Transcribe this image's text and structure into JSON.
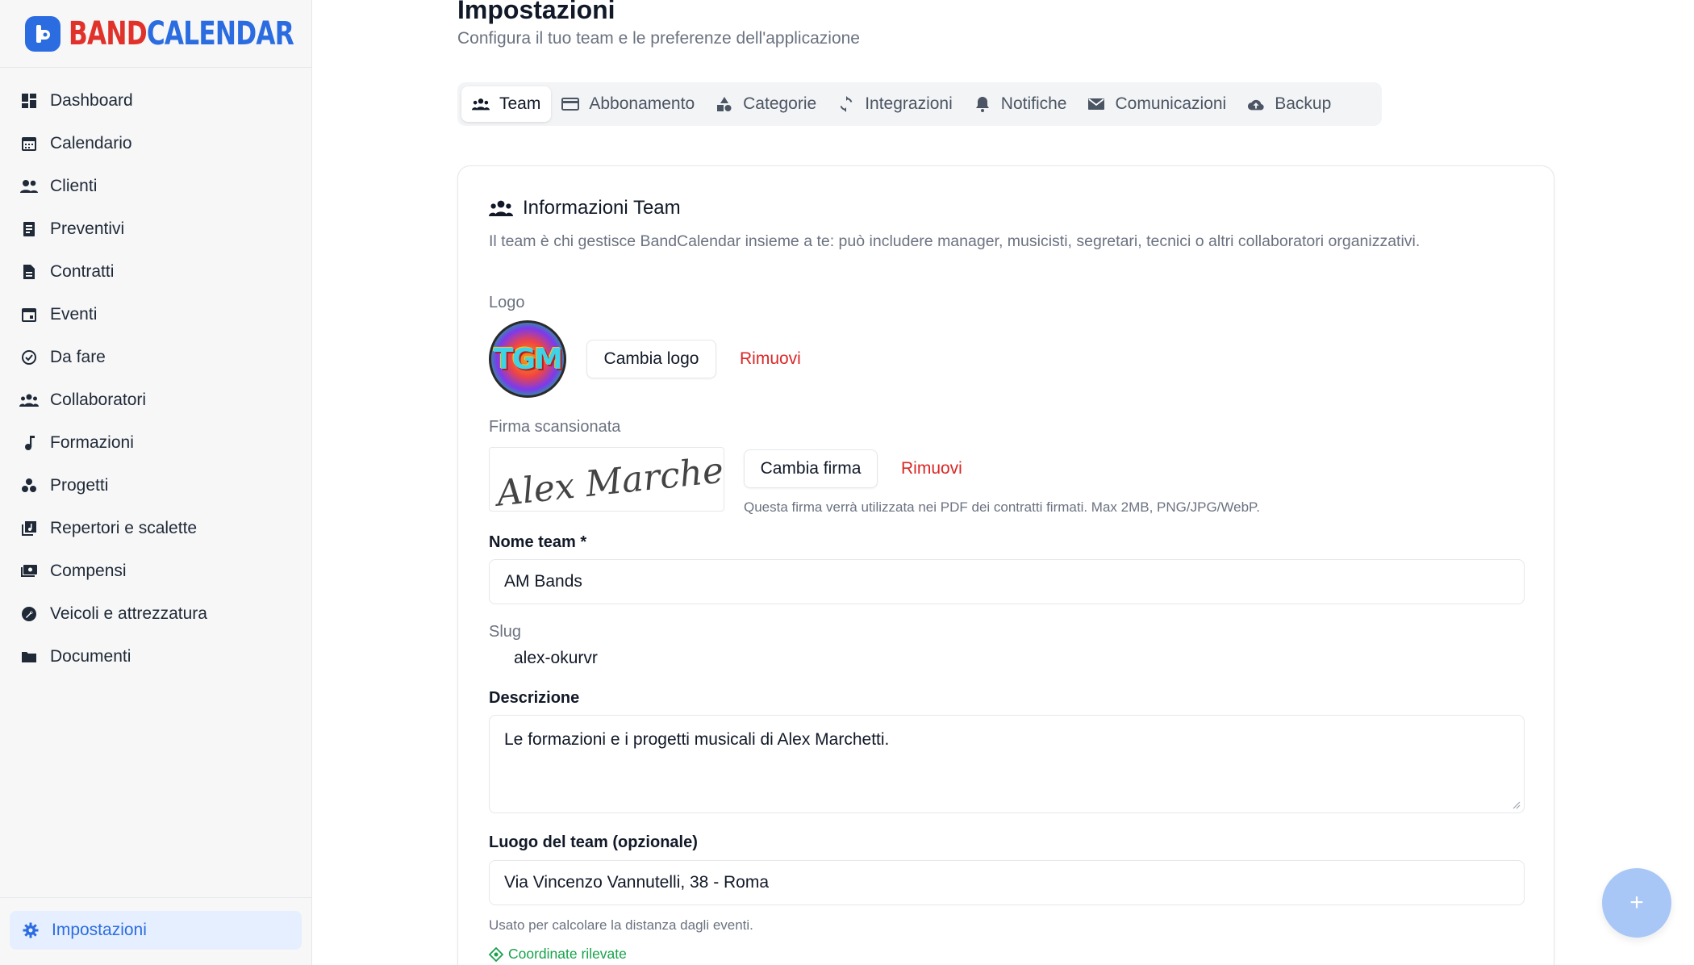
{
  "brand": {
    "part1": "BAND",
    "part2": "CALENDAR",
    "colors": {
      "red": "#e0322b",
      "blue": "#2b6de0"
    }
  },
  "sidebar": {
    "items": [
      {
        "label": "Dashboard",
        "icon": "dashboard-icon"
      },
      {
        "label": "Calendario",
        "icon": "calendar-icon"
      },
      {
        "label": "Clienti",
        "icon": "people-icon"
      },
      {
        "label": "Preventivi",
        "icon": "receipt-icon"
      },
      {
        "label": "Contratti",
        "icon": "document-icon"
      },
      {
        "label": "Eventi",
        "icon": "event-icon"
      },
      {
        "label": "Da fare",
        "icon": "check-circle-icon"
      },
      {
        "label": "Collaboratori",
        "icon": "group-icon"
      },
      {
        "label": "Formazioni",
        "icon": "music-note-icon"
      },
      {
        "label": "Progetti",
        "icon": "workspaces-icon"
      },
      {
        "label": "Repertori e scalette",
        "icon": "library-music-icon"
      },
      {
        "label": "Compensi",
        "icon": "payments-icon"
      },
      {
        "label": "Veicoli e attrezzatura",
        "icon": "build-circle-icon"
      },
      {
        "label": "Documenti",
        "icon": "folder-icon"
      }
    ],
    "active": {
      "label": "Impostazioni",
      "icon": "gear-icon"
    }
  },
  "header": {
    "title": "Impostazioni",
    "subtitle": "Configura il tuo team e le preferenze dell'applicazione"
  },
  "tabs": [
    {
      "label": "Team",
      "icon": "group-icon",
      "active": true
    },
    {
      "label": "Abbonamento",
      "icon": "credit-card-icon",
      "active": false
    },
    {
      "label": "Categorie",
      "icon": "category-icon",
      "active": false
    },
    {
      "label": "Integrazioni",
      "icon": "sync-icon",
      "active": false
    },
    {
      "label": "Notifiche",
      "icon": "bell-icon",
      "active": false
    },
    {
      "label": "Comunicazioni",
      "icon": "mail-icon",
      "active": false
    },
    {
      "label": "Backup",
      "icon": "cloud-upload-icon",
      "active": false
    }
  ],
  "team_card": {
    "title": "Informazioni Team",
    "description": "Il team è chi gestisce BandCalendar insieme a te: può includere manager, musicisti, segretari, tecnici o altri collaboratori organizzativi.",
    "logo": {
      "label": "Logo",
      "image_text": "TGM",
      "change_button": "Cambia logo",
      "remove_link": "Rimuovi"
    },
    "signature": {
      "label": "Firma scansionata",
      "image_text": "Alex Marchetti",
      "change_button": "Cambia firma",
      "remove_link": "Rimuovi",
      "hint": "Questa firma verrà utilizzata nei PDF dei contratti firmati. Max 2MB, PNG/JPG/WebP."
    },
    "team_name": {
      "label": "Nome team *",
      "value": "AM Bands"
    },
    "slug": {
      "label": "Slug",
      "value": "alex-okurvr"
    },
    "description_field": {
      "label": "Descrizione",
      "value": "Le formazioni e i progetti musicali di Alex Marchetti."
    },
    "location": {
      "label": "Luogo del team (opzionale)",
      "value": "Via Vincenzo Vannutelli, 38 - Roma",
      "hint": "Usato per calcolare la distanza dagli eventi.",
      "status": "Coordinate rilevate",
      "status_color": "#16a34a"
    }
  },
  "fab": {
    "label": "+"
  }
}
